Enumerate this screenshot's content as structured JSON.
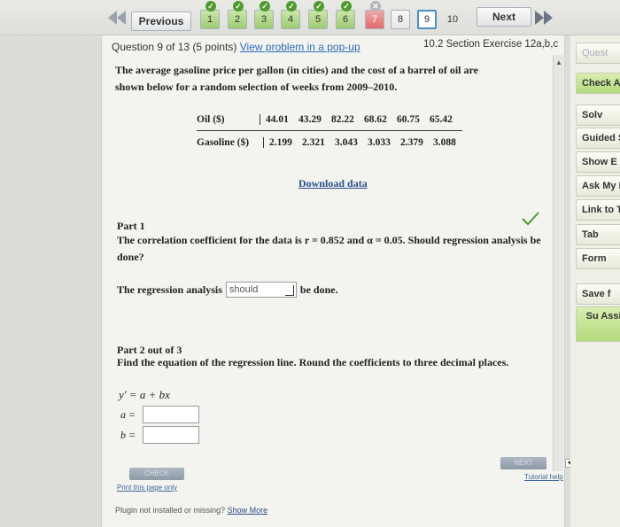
{
  "nav": {
    "previous_label": "Previous",
    "next_label": "Next",
    "questions": [
      {
        "num": "1",
        "status": "done"
      },
      {
        "num": "2",
        "status": "done"
      },
      {
        "num": "3",
        "status": "done"
      },
      {
        "num": "4",
        "status": "done"
      },
      {
        "num": "5",
        "status": "done"
      },
      {
        "num": "6",
        "status": "done"
      },
      {
        "num": "7",
        "status": "wrong"
      },
      {
        "num": "8",
        "status": "plain"
      },
      {
        "num": "9",
        "status": "current"
      },
      {
        "num": "10",
        "status": "plain"
      }
    ]
  },
  "question": {
    "header": "Question 9 of 13 (5 points)",
    "popup_link": "View problem in a pop-up",
    "section": "10.2 Section Exercise 12a,b,c",
    "prompt": "The average gasoline price per gallon (in cities) and the cost of a barrel of oil are shown below for a random selection of weeks from 2009–2010."
  },
  "table": {
    "rows": [
      {
        "label": "Oil ($)",
        "values": [
          "44.01",
          "43.29",
          "82.22",
          "68.62",
          "60.75",
          "65.42"
        ]
      },
      {
        "label": "Gasoline ($)",
        "values": [
          "2.199",
          "2.321",
          "3.043",
          "3.033",
          "2.379",
          "3.088"
        ]
      }
    ]
  },
  "download_label": "Download data",
  "part1": {
    "title": "Part 1",
    "text": "The correlation coefficient for the data is r = 0.852 and α = 0.05. Should regression analysis be done?",
    "answer_prefix": "The regression analysis",
    "answer_value": "should",
    "answer_suffix": "be done."
  },
  "part2": {
    "title": "Part 2 out of 3",
    "text": "Find the equation of the regression line. Round the coefficients to three decimal places.",
    "equation": "y' = a + bx",
    "a_label": "a =",
    "b_label": "b ="
  },
  "buttons": {
    "check": "CHECK",
    "next": "NEXT",
    "print": "Print this page only",
    "tutorial": "Tutorial help"
  },
  "plugin": {
    "message": "Plugin not installed or missing?",
    "link": "Show More"
  },
  "sidebar": [
    {
      "label": "Quest",
      "style": "dim"
    },
    {
      "label": "Check A",
      "style": "green"
    },
    {
      "label": "Solv",
      "style": "normal"
    },
    {
      "label": "Guided S",
      "style": "normal"
    },
    {
      "label": "Show E",
      "style": "normal"
    },
    {
      "label": "Ask My In",
      "style": "normal"
    },
    {
      "label": "Link to T",
      "style": "normal"
    },
    {
      "label": "Tab",
      "style": "normal"
    },
    {
      "label": "Form",
      "style": "normal"
    },
    {
      "label": "Save f",
      "style": "normal"
    },
    {
      "label": "Su Assig",
      "style": "green"
    }
  ]
}
